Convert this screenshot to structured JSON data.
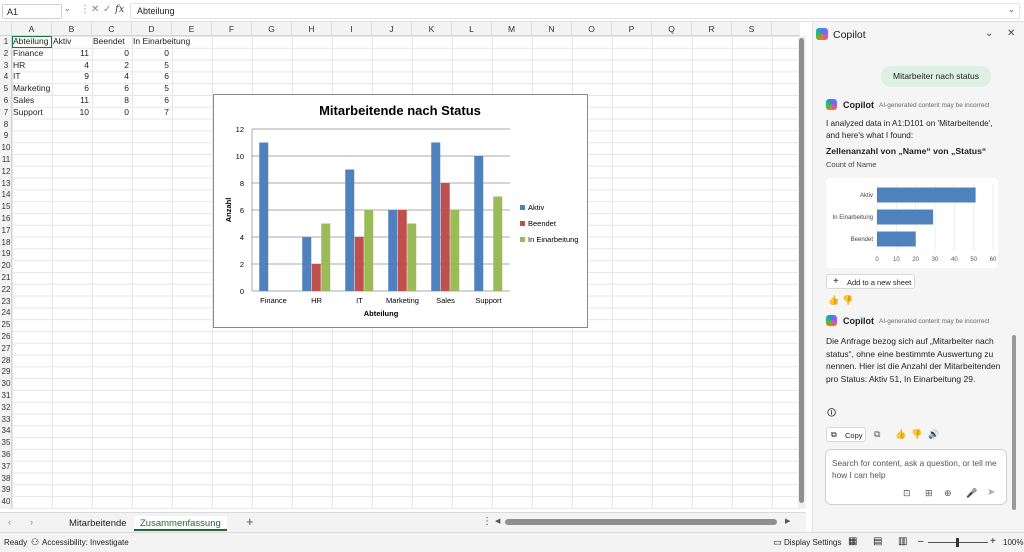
{
  "formula_bar": {
    "name_box": "A1",
    "formula": "Abteilung"
  },
  "columns": [
    "A",
    "B",
    "C",
    "D",
    "E",
    "F",
    "G",
    "H",
    "I",
    "J",
    "K",
    "L",
    "M",
    "N",
    "O",
    "P",
    "Q",
    "R",
    "S"
  ],
  "rows": [
    "1",
    "2",
    "3",
    "4",
    "5",
    "6",
    "7",
    "8",
    "9",
    "10",
    "11",
    "12",
    "13",
    "14",
    "15",
    "16",
    "17",
    "18",
    "19",
    "20",
    "21",
    "22",
    "23",
    "24",
    "25",
    "26",
    "27",
    "28",
    "29",
    "30",
    "31",
    "32",
    "33",
    "34",
    "35",
    "36",
    "37",
    "38",
    "39",
    "40"
  ],
  "table": {
    "headers": [
      "Abteilung",
      "Aktiv",
      "Beendet",
      "In Einarbeitung"
    ],
    "rows": [
      [
        "Finance",
        "11",
        "0",
        "0"
      ],
      [
        "HR",
        "4",
        "2",
        "5"
      ],
      [
        "IT",
        "9",
        "4",
        "6"
      ],
      [
        "Marketing",
        "6",
        "6",
        "5"
      ],
      [
        "Sales",
        "11",
        "8",
        "6"
      ],
      [
        "Support",
        "10",
        "0",
        "7"
      ]
    ]
  },
  "chart_data": {
    "type": "bar",
    "title": "Mitarbeitende nach Status",
    "xlabel": "Abteilung",
    "ylabel": "Anzahl",
    "categories": [
      "Finance",
      "HR",
      "IT",
      "Marketing",
      "Sales",
      "Support"
    ],
    "series": [
      {
        "name": "Aktiv",
        "values": [
          11,
          4,
          9,
          6,
          11,
          10
        ],
        "color": "#4f81bd"
      },
      {
        "name": "Beendet",
        "values": [
          0,
          2,
          4,
          6,
          8,
          0
        ],
        "color": "#c0504d"
      },
      {
        "name": "In Einarbeitung",
        "values": [
          0,
          5,
          6,
          5,
          6,
          7
        ],
        "color": "#9bbb59"
      }
    ],
    "ylim": [
      0,
      12
    ],
    "yticks": [
      "0",
      "2",
      "4",
      "6",
      "8",
      "10",
      "12"
    ],
    "grid": true,
    "legend": "right"
  },
  "sheet_tabs": [
    "Mitarbeitende",
    "Zusammenfassung"
  ],
  "status": {
    "ready": "Ready",
    "accessibility": "Accessibility: Investigate",
    "display_settings": "Display Settings",
    "zoom": "100%"
  },
  "copilot": {
    "title": "Copilot",
    "user_message": "Mitarbeiter nach status",
    "name": "Copilot",
    "disclaimer": "AI-generated content may be incorrect",
    "analysis_intro": "I analyzed data in A1:D101 on 'Mitarbeitende', and here's what I found:",
    "result_title": "Zellenanzahl von „Name“ von „Status“",
    "result_sub": "Count of Name",
    "mini_chart": {
      "type": "bar",
      "categories": [
        "Aktiv",
        "In Einarbeitung",
        "Beendet"
      ],
      "values": [
        51,
        29,
        20
      ],
      "ticks": [
        "0",
        "10",
        "20",
        "30",
        "40",
        "50",
        "60"
      ],
      "color": "#4f81bd"
    },
    "add_sheet": "Add to a new sheet",
    "reply": "Die Anfrage bezog sich auf „Mitarbeiter nach status“, ohne eine bestimmte Auswertung zu nennen. Hier ist die Anzahl der Mitarbeitenden pro Status: Aktiv 51, In Einarbeitung 29.",
    "copy": "Copy",
    "input_placeholder": "Search for content, ask a question, or tell me how I can help"
  }
}
